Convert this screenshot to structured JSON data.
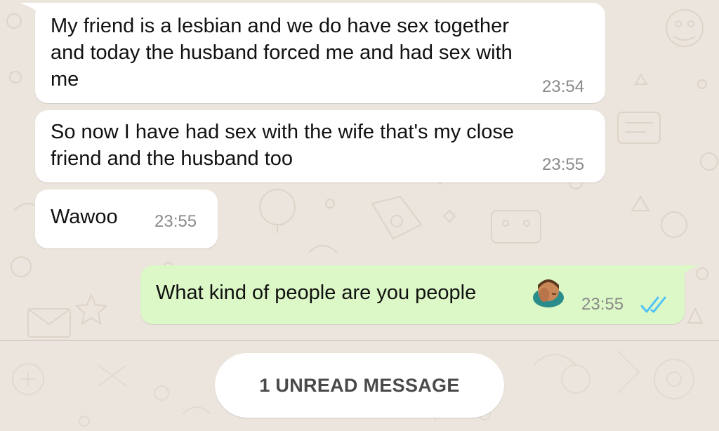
{
  "colors": {
    "wallpaper": "#ECE5DD",
    "incoming_bubble": "#FFFFFF",
    "outgoing_bubble": "#DCF8C6",
    "read_ticks": "#4FC3F7",
    "timestamp": "#8A8A8A"
  },
  "messages": [
    {
      "direction": "incoming",
      "text": "My friend is a lesbian and we do have sex together\nand today the husband forced me and had sex with\nme",
      "time": "23:54"
    },
    {
      "direction": "incoming",
      "text": "So now I have had sex with the wife that's my close\nfriend and the husband too",
      "time": "23:55"
    },
    {
      "direction": "incoming",
      "text": "Wawoo",
      "time": "23:55"
    },
    {
      "direction": "outgoing",
      "text": "What kind of people are you people",
      "emoji": "face-palm-icon",
      "time": "23:55",
      "status": "read"
    }
  ],
  "unread_banner": {
    "label": "1 UNREAD MESSAGE"
  }
}
